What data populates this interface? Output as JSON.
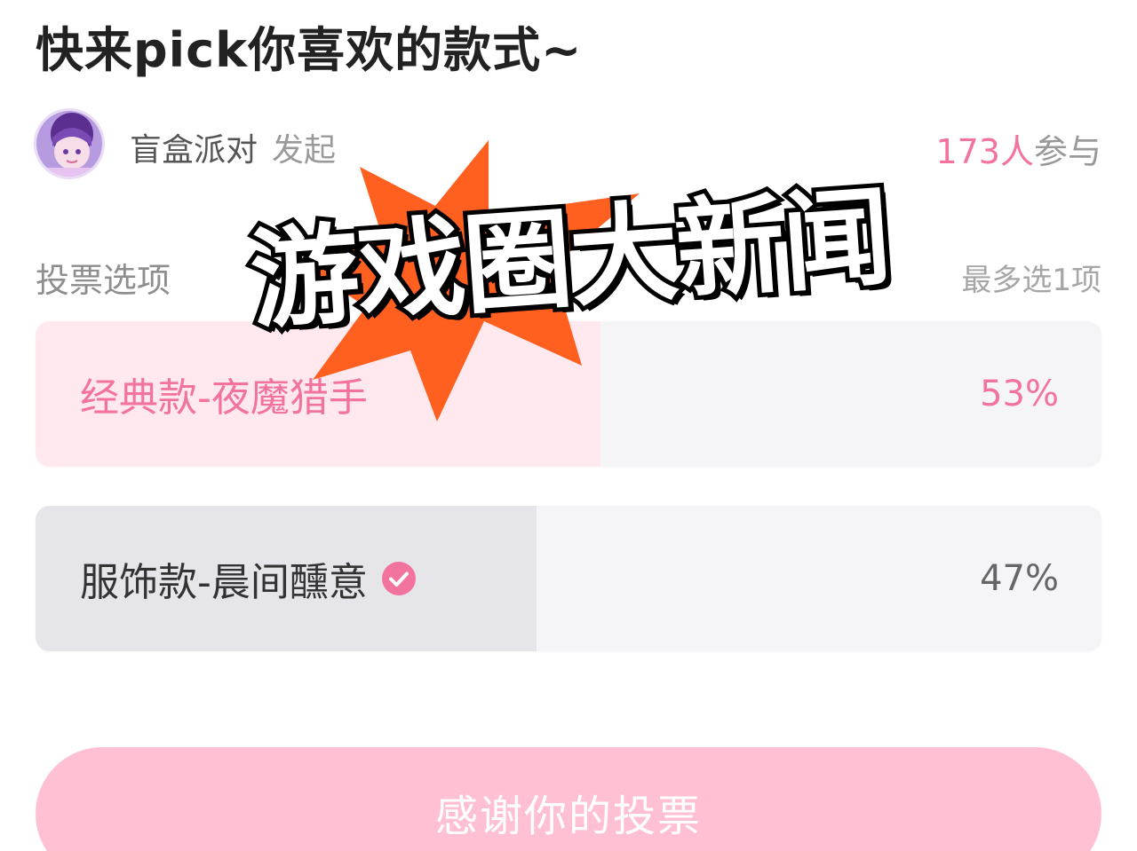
{
  "poll": {
    "title": "快来pick你喜欢的款式~",
    "initiator": {
      "name": "盲盒派对",
      "suffix": "发起"
    },
    "participants": {
      "count": "173人",
      "unit": "参与"
    },
    "section_label": "投票选项",
    "limit_label": "最多选1项",
    "options": [
      {
        "label": "经典款-夜魔猎手",
        "percent": "53%",
        "fraction": 0.53,
        "fill_color": "#ffe9ef",
        "text_color": "#f2739e",
        "selected": false
      },
      {
        "label": "服饰款-晨间醺意",
        "percent": "47%",
        "fraction": 0.47,
        "fill_color": "#e6e6ea",
        "text_color": "#333333",
        "selected": true,
        "check_icon": "check-circle-icon"
      }
    ],
    "submit_label": "感谢你的投票"
  },
  "overlay": {
    "headline": "游戏圈大新闻",
    "burst_color": "#ff5f1f"
  },
  "colors": {
    "accent": "#f2739e",
    "submit_bg": "#ffc0d3"
  }
}
